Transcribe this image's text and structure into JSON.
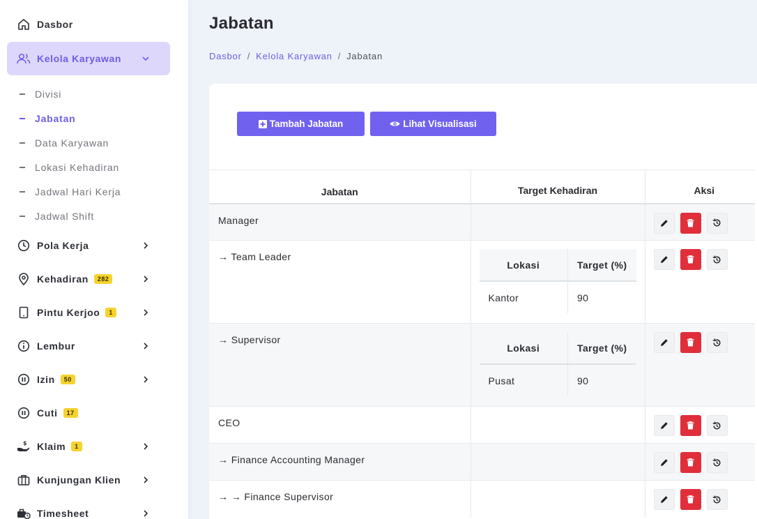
{
  "sidebar": {
    "dasbor": "Dasbor",
    "kelola": "Kelola Karyawan",
    "sub": {
      "divisi": "Divisi",
      "jabatan": "Jabatan",
      "data_karyawan": "Data Karyawan",
      "lokasi": "Lokasi Kehadiran",
      "jadwal_hari": "Jadwal Hari Kerja",
      "jadwal_shift": "Jadwal Shift"
    },
    "pola_kerja": "Pola Kerja",
    "kehadiran": "Kehadiran",
    "kehadiran_badge": "282",
    "pintu": "Pintu Kerjoo",
    "pintu_badge": "1",
    "lembur": "Lembur",
    "izin": "Izin",
    "izin_badge": "50",
    "cuti": "Cuti",
    "cuti_badge": "17",
    "klaim": "Klaim",
    "klaim_badge": "1",
    "kunjungan": "Kunjungan Klien",
    "timesheet": "Timesheet"
  },
  "header": {
    "title": "Jabatan",
    "breadcrumb": [
      "Dasbor",
      "Kelola Karyawan",
      "Jabatan"
    ],
    "separator": "/"
  },
  "toolbar": {
    "add_label": "Tambah Jabatan",
    "visual_label": "Lihat Visualisasi"
  },
  "table": {
    "headers": [
      "Jabatan",
      "Target Kehadiran",
      "Aksi"
    ],
    "inner_headers": [
      "Lokasi",
      "Target (%)"
    ],
    "rows": [
      {
        "name": "Manager"
      },
      {
        "name": "→ Team Leader",
        "lokasi": "Kantor",
        "target": "90"
      },
      {
        "name": "→ Supervisor",
        "lokasi": "Pusat",
        "target": "90"
      },
      {
        "name": "CEO"
      },
      {
        "name": "→ Finance Accounting Manager"
      },
      {
        "name": "→ → Finance Supervisor"
      }
    ]
  },
  "colors": {
    "accent": "#6c5ce7",
    "button": "#7061ef",
    "danger": "#e02f3b",
    "badge": "#f6d32d"
  }
}
